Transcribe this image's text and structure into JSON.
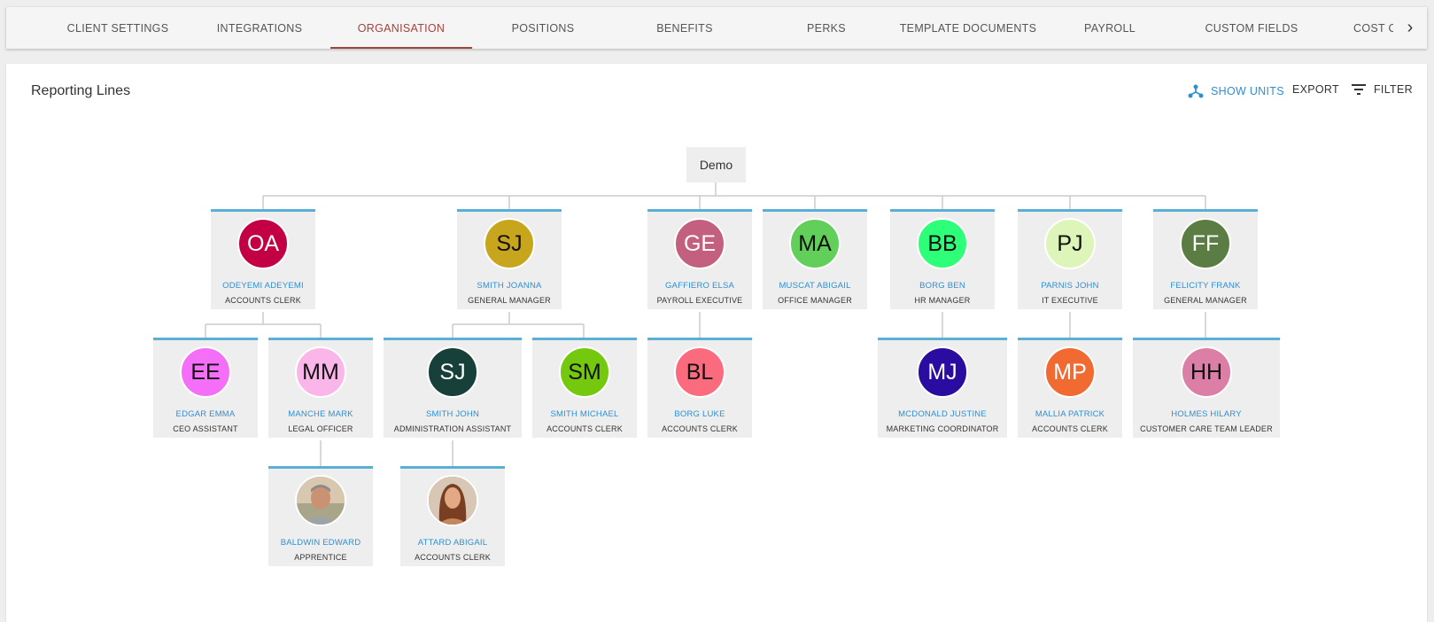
{
  "tabs": [
    {
      "label": "CLIENT SETTINGS",
      "active": false
    },
    {
      "label": "INTEGRATIONS",
      "active": false
    },
    {
      "label": "ORGANISATION",
      "active": true
    },
    {
      "label": "POSITIONS",
      "active": false
    },
    {
      "label": "BENEFITS",
      "active": false
    },
    {
      "label": "PERKS",
      "active": false
    },
    {
      "label": "TEMPLATE DOCUMENTS",
      "active": false
    },
    {
      "label": "PAYROLL",
      "active": false
    },
    {
      "label": "CUSTOM FIELDS",
      "active": false
    },
    {
      "label": "COST C",
      "active": false
    }
  ],
  "tab_next_icon": "chevron-right-icon",
  "card": {
    "title": "Reporting Lines",
    "show_units_label": "SHOW UNITS",
    "export_label": "EXPORT",
    "filter_label": "FILTER"
  },
  "colors": {
    "accent": "#2f8fd3",
    "tab_active": "#a1453b",
    "node_border": "#5aafd6"
  },
  "org": {
    "root": "Demo",
    "nodes": [
      {
        "id": "oa",
        "initials": "OA",
        "name": "ODEYEMI ADEYEMI",
        "role": "ACCOUNTS CLERK",
        "color": "#c30044",
        "text_color": "#ffffff"
      },
      {
        "id": "sj",
        "initials": "SJ",
        "name": "SMITH JOANNA",
        "role": "GENERAL MANAGER",
        "color": "#c7a51d",
        "text_color": "#111111"
      },
      {
        "id": "ge",
        "initials": "GE",
        "name": "GAFFIERO ELSA",
        "role": "PAYROLL EXECUTIVE",
        "color": "#c4607f",
        "text_color": "#ffffff"
      },
      {
        "id": "ma",
        "initials": "MA",
        "name": "MUSCAT ABIGAIL",
        "role": "OFFICE MANAGER",
        "color": "#62cf5a",
        "text_color": "#111111"
      },
      {
        "id": "bb",
        "initials": "BB",
        "name": "BORG BEN",
        "role": "HR MANAGER",
        "color": "#2eff78",
        "text_color": "#111111"
      },
      {
        "id": "pj",
        "initials": "PJ",
        "name": "PARNIS JOHN",
        "role": "IT EXECUTIVE",
        "color": "#ddf5b8",
        "text_color": "#111111"
      },
      {
        "id": "ff",
        "initials": "FF",
        "name": "FELICITY FRANK",
        "role": "GENERAL MANAGER",
        "color": "#5b7d43",
        "text_color": "#ffffff"
      },
      {
        "id": "ee",
        "initials": "EE",
        "name": "EDGAR EMMA",
        "role": "CEO ASSISTANT",
        "color": "#f46ef7",
        "text_color": "#111111"
      },
      {
        "id": "mm",
        "initials": "MM",
        "name": "MANCHE MARK",
        "role": "LEGAL OFFICER",
        "color": "#fab6e8",
        "text_color": "#111111"
      },
      {
        "id": "sjo",
        "initials": "SJ",
        "name": "SMITH JOHN",
        "role": "ADMINISTRATION ASSISTANT",
        "color": "#17403a",
        "text_color": "#ffffff"
      },
      {
        "id": "sm",
        "initials": "SM",
        "name": "SMITH MICHAEL",
        "role": "ACCOUNTS CLERK",
        "color": "#74c80e",
        "text_color": "#111111"
      },
      {
        "id": "bl",
        "initials": "BL",
        "name": "BORG LUKE",
        "role": "ACCOUNTS CLERK",
        "color": "#fb6b7e",
        "text_color": "#111111"
      },
      {
        "id": "mj",
        "initials": "MJ",
        "name": "MCDONALD JUSTINE",
        "role": "MARKETING COORDINATOR",
        "color": "#2a0da0",
        "text_color": "#ffffff"
      },
      {
        "id": "mp",
        "initials": "MP",
        "name": "MALLIA PATRICK",
        "role": "ACCOUNTS CLERK",
        "color": "#f06a32",
        "text_color": "#ffffff"
      },
      {
        "id": "hh",
        "initials": "HH",
        "name": "HOLMES HILARY",
        "role": "CUSTOMER CARE TEAM LEADER",
        "color": "#dc7fa6",
        "text_color": "#111111"
      },
      {
        "id": "be",
        "initials": "",
        "name": "BALDWIN EDWARD",
        "role": "APPRENTICE",
        "color": "#c8b39a",
        "text_color": "#111111",
        "photo": "man-photo"
      },
      {
        "id": "aa",
        "initials": "",
        "name": "ATTARD ABIGAIL",
        "role": "ACCOUNTS CLERK",
        "color": "#b07a55",
        "text_color": "#111111",
        "photo": "woman-photo"
      }
    ]
  }
}
